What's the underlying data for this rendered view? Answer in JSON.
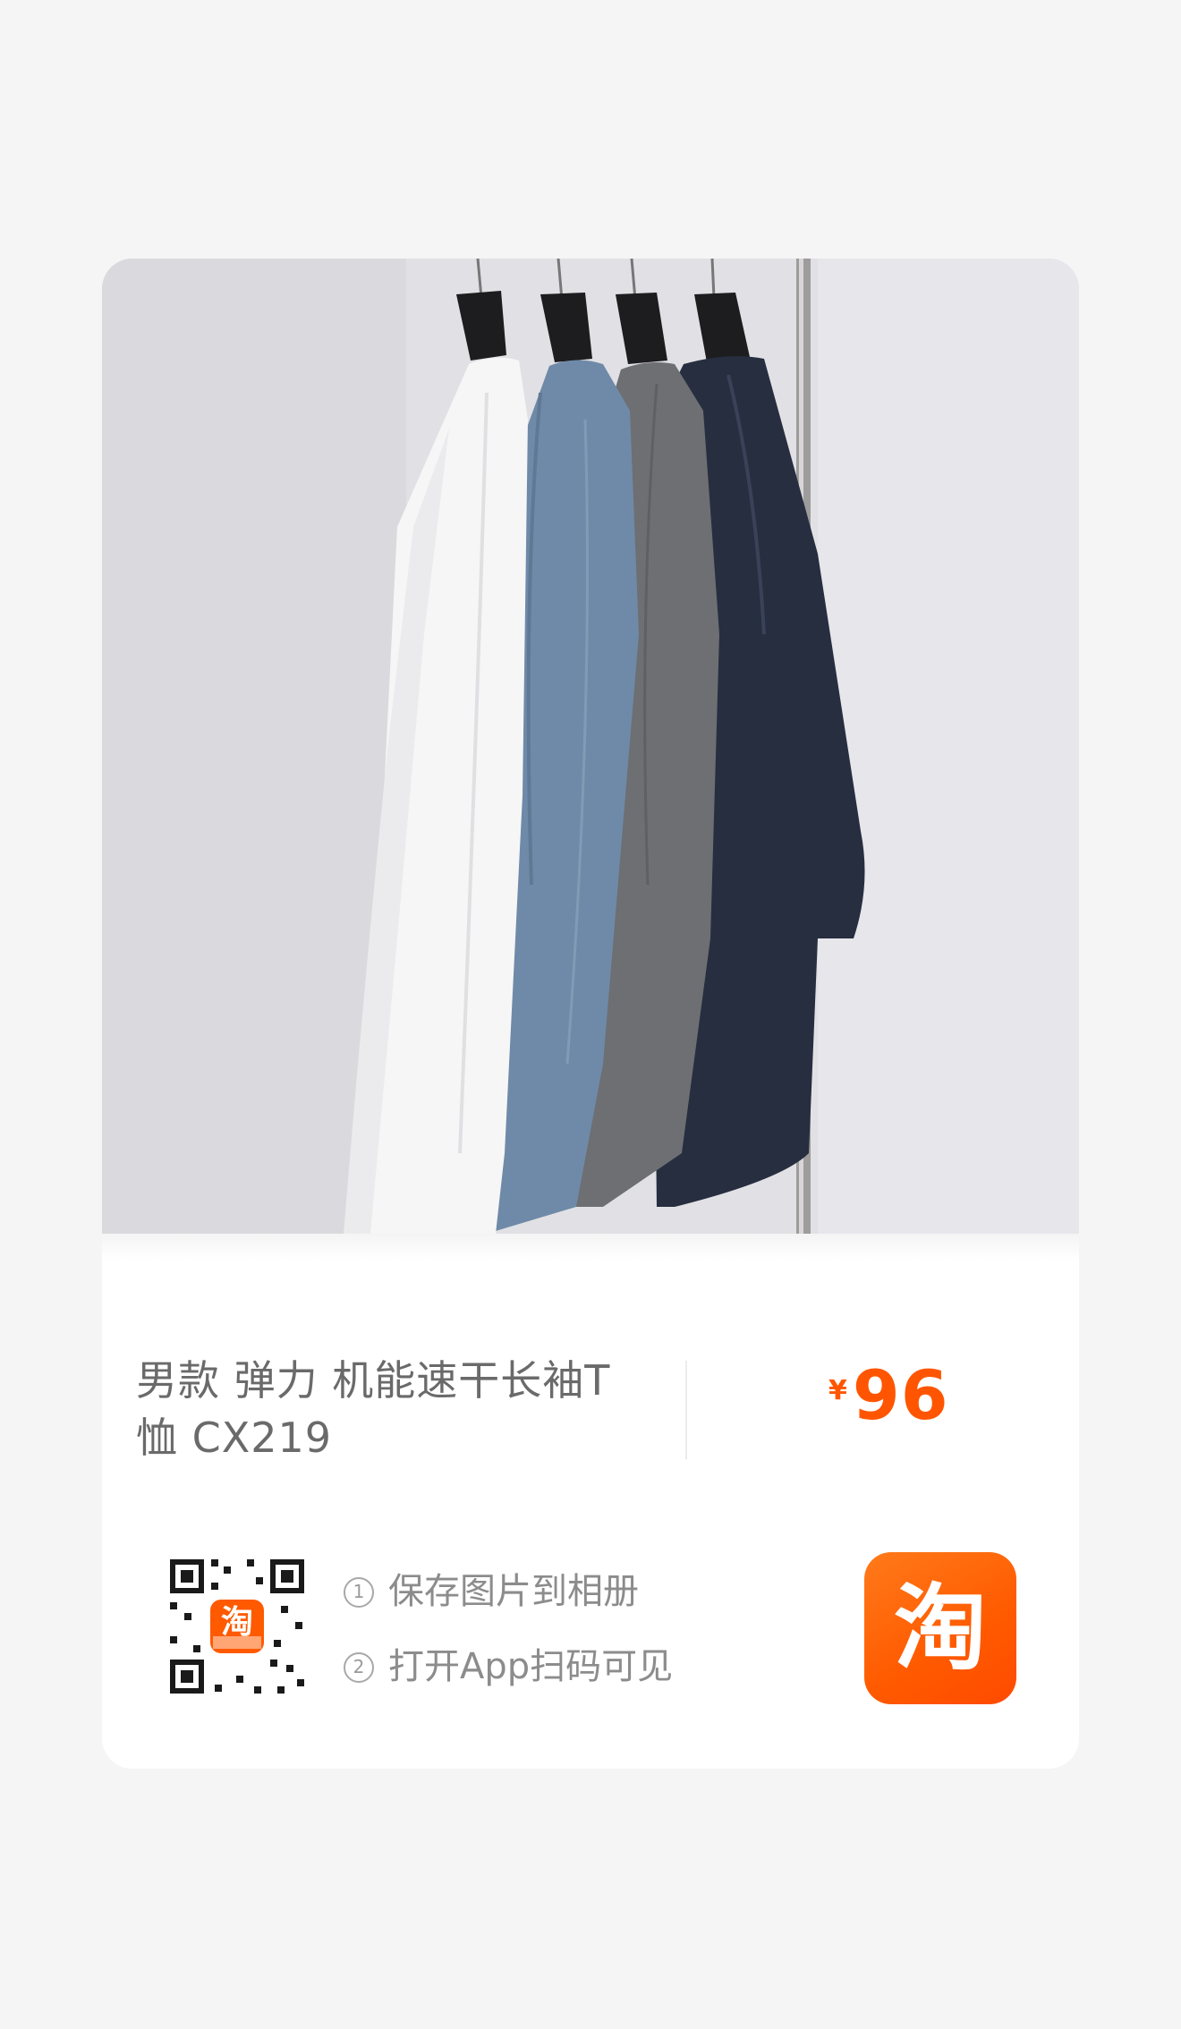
{
  "product": {
    "title": "男款 弹力 机能速干长袖T恤 CX219",
    "price_symbol": "¥",
    "price_value": "96"
  },
  "photo": {
    "description_alt": "Four long-sleeve T-shirts on hangers: white, blue, grey, navy"
  },
  "share": {
    "step1_num": "1",
    "step1_text": "保存图片到相册",
    "step2_num": "2",
    "step2_text": "打开App扫码可见"
  },
  "qr": {
    "center_logo_text": "淘"
  },
  "brand": {
    "logo_text": "淘",
    "color": "#ff5500"
  }
}
